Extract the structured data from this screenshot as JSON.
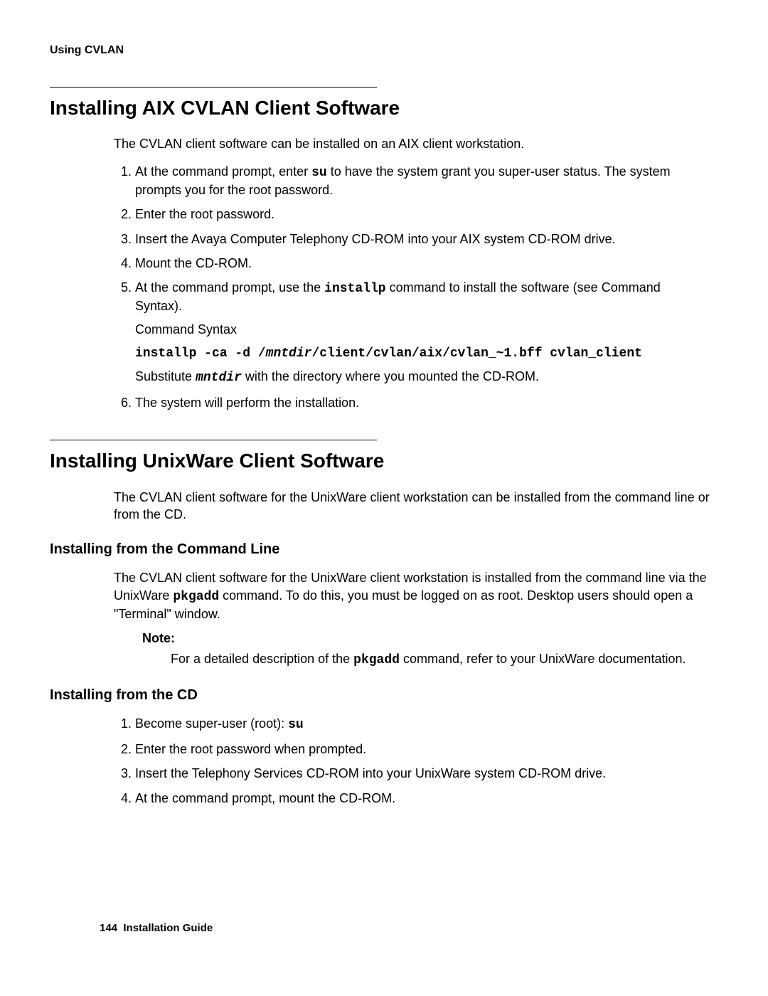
{
  "running_head": "Using CVLAN",
  "section1": {
    "title": "Installing AIX CVLAN Client Software",
    "intro": "The CVLAN client software can be installed on an AIX client workstation.",
    "step1a": "At the command prompt, enter ",
    "step1_cmd": "su",
    "step1b": " to have the system grant you super-user status. The system prompts you for the root password.",
    "step2": "Enter the root password.",
    "step3": "Insert the Avaya Computer Telephony CD-ROM into your AIX system CD-ROM drive.",
    "step4": "Mount the CD-ROM.",
    "step5a": "At the command prompt, use the ",
    "step5_cmd": "installp",
    "step5b": " command to install the software (see Command Syntax).",
    "step5_syntax_label": "Command Syntax",
    "step5_syntax_pre": "installp -ca -d /",
    "step5_syntax_var": "mntdir",
    "step5_syntax_post": "/client/cvlan/aix/cvlan_~1.bff cvlan_client",
    "step5_sub_a": "Substitute ",
    "step5_sub_var": "mntdir",
    "step5_sub_b": " with the directory where you mounted the CD-ROM.",
    "step6": "The system will perform the installation."
  },
  "section2": {
    "title": "Installing UnixWare Client Software",
    "intro": "The CVLAN client software for the UnixWare client workstation can be installed from the command line or from the CD.",
    "sub1_title": "Installing from the Command Line",
    "sub1_body_a": "The CVLAN client software for the UnixWare client workstation is installed from the command line via the UnixWare ",
    "sub1_cmd": "pkgadd",
    "sub1_body_b": " command. To do this, you must be logged on as root. Desktop users should open a \"Terminal\" window.",
    "note_label": "Note:",
    "note_body_a": "For a detailed description of the ",
    "note_cmd": "pkgadd",
    "note_body_b": " command, refer to your UnixWare documentation.",
    "sub2_title": "Installing from the CD",
    "s2_step1a": "Become super-user (root):  ",
    "s2_step1_cmd": "su",
    "s2_step2": "Enter the root password when prompted.",
    "s2_step3": "Insert the Telephony Services CD-ROM into your UnixWare system CD-ROM drive.",
    "s2_step4": "At the command prompt, mount the CD-ROM."
  },
  "footer": {
    "page": "144",
    "label": "Installation Guide"
  }
}
